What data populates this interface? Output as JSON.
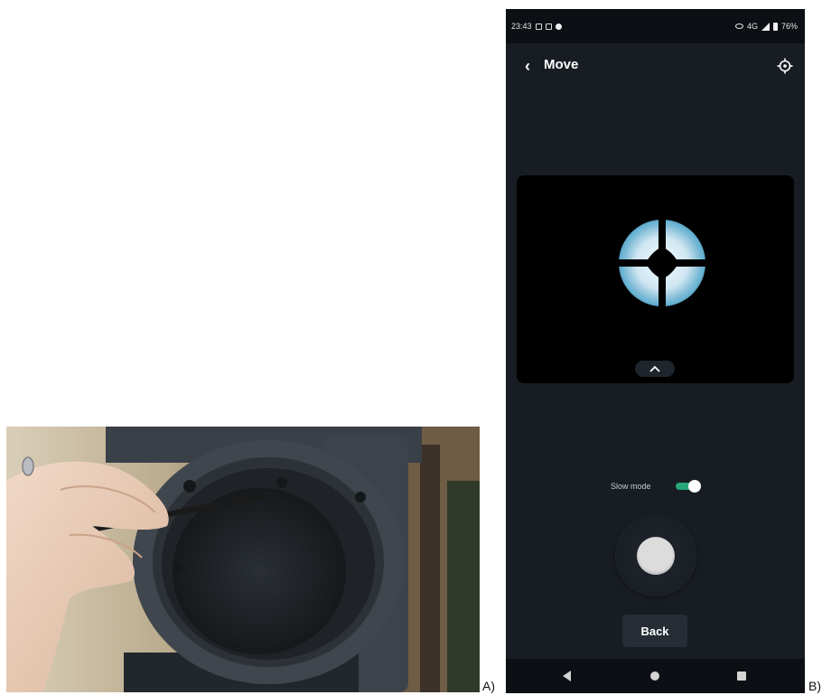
{
  "labels": {
    "panel_a": "A)",
    "panel_b": "B)"
  },
  "status_bar": {
    "time": "23:43",
    "network": "4G",
    "battery": "76%"
  },
  "app": {
    "title": "Move"
  },
  "icons": {
    "back": "back-arrow-icon",
    "target": "crosshair-target-icon",
    "collapse": "chevron-up-icon"
  },
  "controls": {
    "slow_mode_label": "Slow mode",
    "slow_mode_on": true,
    "back_button": "Back"
  },
  "colors": {
    "app_background": "#181d23",
    "toggle_on": "#28a77a",
    "status_bar": "#0c0f13"
  }
}
